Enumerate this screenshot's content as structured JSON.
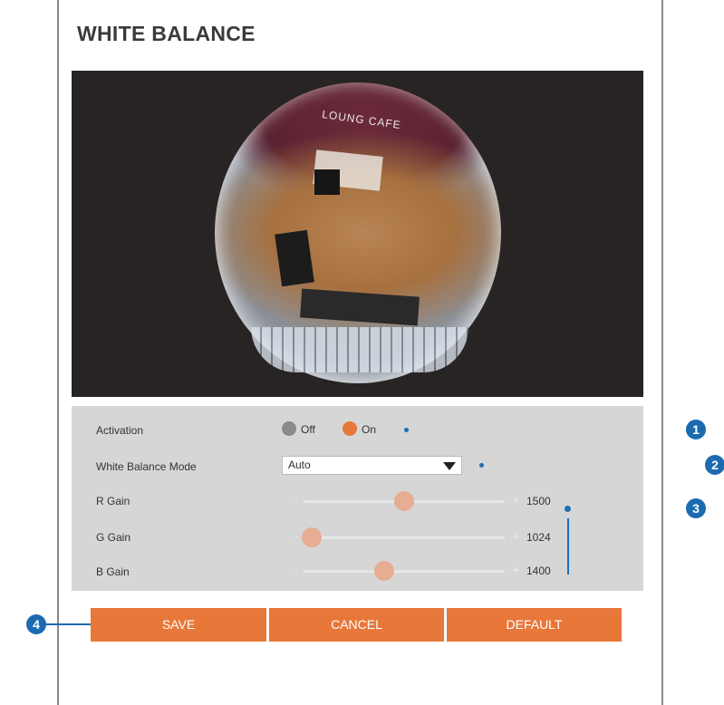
{
  "page": {
    "title": "WHITE BALANCE"
  },
  "video": {
    "sign_text": "LOUNG CAFE"
  },
  "settings": {
    "activation": {
      "label": "Activation",
      "off_label": "Off",
      "on_label": "On",
      "selected": "On"
    },
    "mode": {
      "label": "White Balance Mode",
      "value": "Auto"
    },
    "r_gain": {
      "label": "R Gain",
      "value": "1500",
      "level": 0.5
    },
    "g_gain": {
      "label": "G Gain",
      "value": "1024",
      "level": 0.04
    },
    "b_gain": {
      "label": "B Gain",
      "value": "1400",
      "level": 0.4
    },
    "minus_symbol": "-",
    "plus_symbol": "+"
  },
  "buttons": {
    "save": "SAVE",
    "cancel": "CANCEL",
    "default": "DEFAULT"
  },
  "callouts": {
    "one": "1",
    "two": "2",
    "three": "3",
    "four": "4"
  },
  "colors": {
    "accent": "#e8773a",
    "callout": "#1b6bb0",
    "panel": "#d6d6d6",
    "video_bg": "#282424"
  }
}
